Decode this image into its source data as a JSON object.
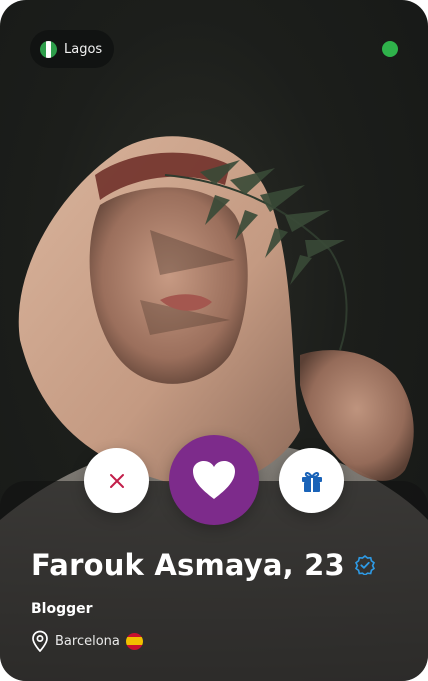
{
  "header": {
    "location_label": "Lagos",
    "location_flag": "nigeria-flag-icon",
    "online_status_color": "#2fb24b"
  },
  "profile": {
    "name_age": "Farouk Asmaya, 23",
    "verified_icon": "verified-badge-icon",
    "occupation": "Blogger",
    "city": "Barcelona",
    "city_flag": "spain-flag-icon"
  },
  "actions": {
    "pass_icon": "close-icon",
    "like_icon": "heart-icon",
    "gift_icon": "gift-icon"
  },
  "colors": {
    "accent": "#7d2b8b",
    "pass": "#c21e4a",
    "gift": "#1a63b8",
    "verified": "#2e9be6"
  }
}
